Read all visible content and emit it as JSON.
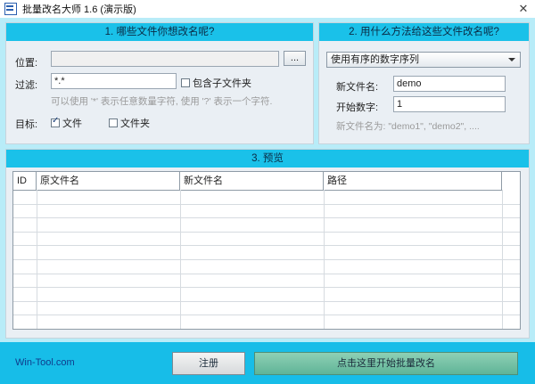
{
  "window": {
    "title": "批量改名大师 1.6 (演示版)",
    "close_glyph": "✕"
  },
  "section1": {
    "header": "1. 哪些文件你想改名呢?",
    "location_label": "位置:",
    "location_value": "",
    "browse_label": "...",
    "filter_label": "过滤:",
    "filter_value": "*.*",
    "include_subfolders_label": "包含子文件夹",
    "include_subfolders_checked": false,
    "hint": "可以使用 '*' 表示任意数量字符, 使用 '?' 表示一个字符.",
    "target_label": "目标:",
    "target_file_label": "文件",
    "target_file_checked": true,
    "target_folder_label": "文件夹",
    "target_folder_checked": false
  },
  "section2": {
    "header": "2. 用什么方法给这些文件改名呢?",
    "method_selected": "使用有序的数字序列",
    "new_name_label": "新文件名:",
    "new_name_value": "demo",
    "start_number_label": "开始数字:",
    "start_number_value": "1",
    "preview_hint": "新文件名为:  \"demo1\", \"demo2\", ...."
  },
  "section3": {
    "header": "3. 预览",
    "columns": [
      "ID",
      "原文件名",
      "新文件名",
      "路径"
    ],
    "rows": []
  },
  "footer": {
    "brand": "Win-Tool.com",
    "register_label": "注册",
    "start_label": "点击这里开始批量改名"
  },
  "colors": {
    "header_bg": "#1ac1e9",
    "frame_bg": "#b8ecf8",
    "start_button": "#6fbf9f"
  }
}
